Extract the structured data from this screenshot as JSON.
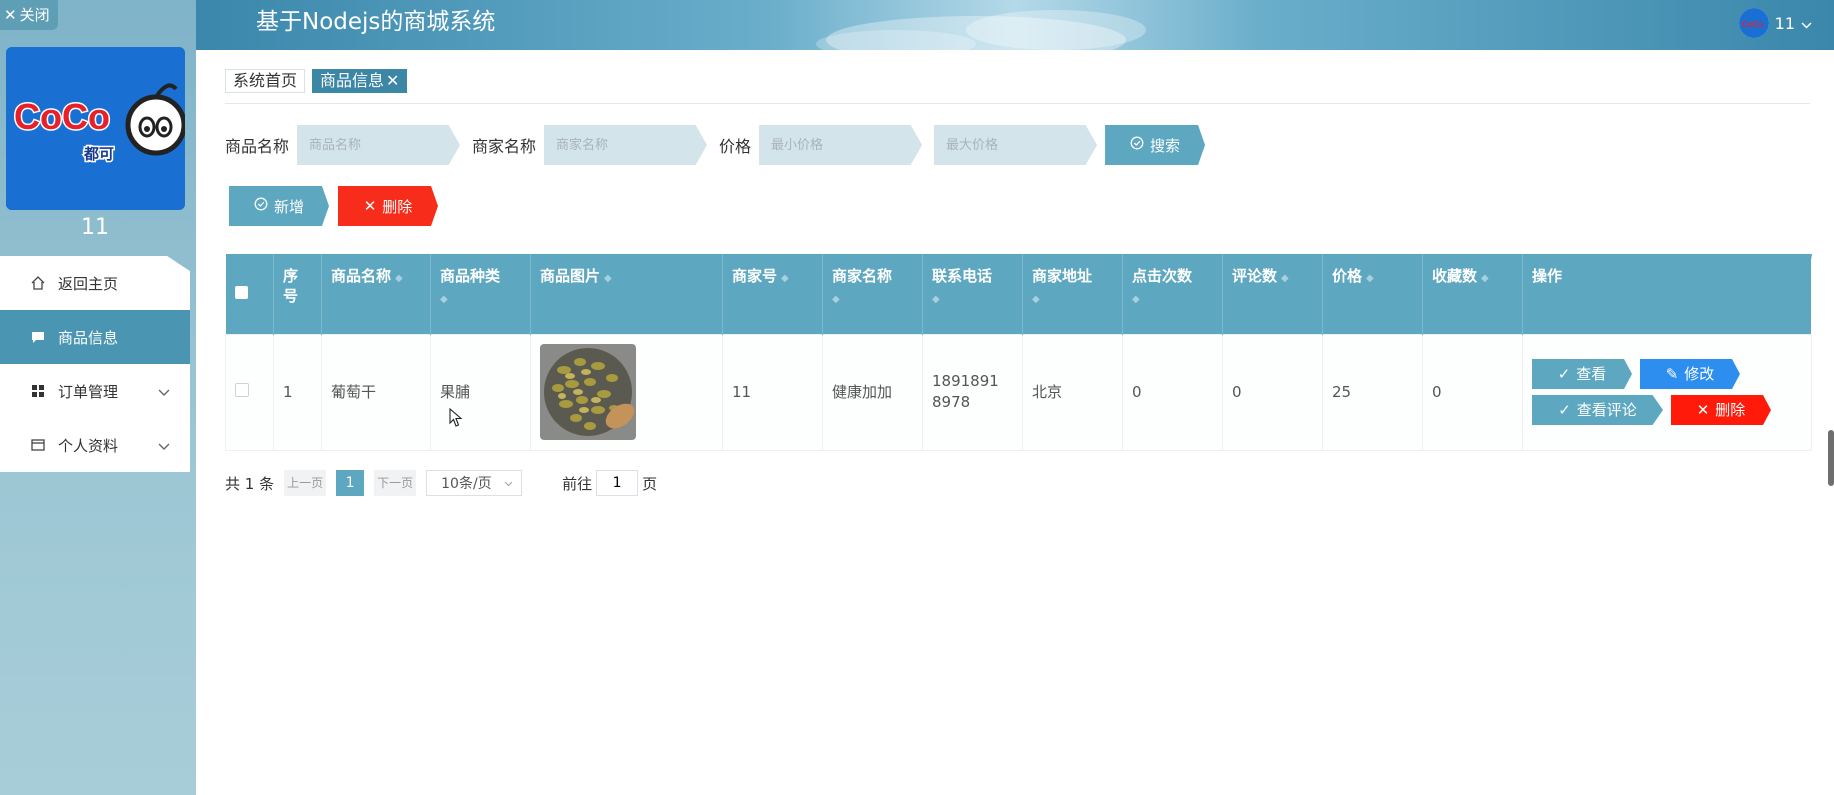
{
  "sidebar": {
    "close_label": "关闭",
    "username": "11",
    "logo_text": "CoCo",
    "logo_subtext": "都可",
    "items": [
      {
        "label": "返回主页",
        "icon": "home-icon"
      },
      {
        "label": "商品信息",
        "icon": "chat-icon"
      },
      {
        "label": "订单管理",
        "icon": "grid-icon"
      },
      {
        "label": "个人资料",
        "icon": "card-icon"
      }
    ]
  },
  "header": {
    "title": "基于Nodejs的商城系统",
    "username": "11"
  },
  "tabs": [
    {
      "label": "系统首页"
    },
    {
      "label": "商品信息"
    }
  ],
  "search": {
    "product_name_label": "商品名称",
    "product_name_placeholder": "商品名称",
    "merchant_name_label": "商家名称",
    "merchant_name_placeholder": "商家名称",
    "price_label": "价格",
    "min_price_placeholder": "最小价格",
    "max_price_placeholder": "最大价格",
    "search_button": "搜索"
  },
  "actions": {
    "add_button": "新增",
    "delete_button": "删除"
  },
  "table": {
    "headers": [
      "序号",
      "商品名称",
      "商品种类",
      "商品图片",
      "商家号",
      "商家名称",
      "联系电话",
      "商家地址",
      "点击次数",
      "评论数",
      "价格",
      "收藏数",
      "操作"
    ],
    "rows": [
      {
        "index": "1",
        "name": "葡萄干",
        "category": "果脯",
        "merchant_no": "11",
        "merchant_name": "健康加加",
        "phone": "18918918978",
        "address": "北京",
        "clicks": "0",
        "comments": "0",
        "price": "25",
        "favorites": "0"
      }
    ],
    "ops": {
      "view": "查看",
      "edit": "修改",
      "view_comments": "查看评论",
      "delete": "删除"
    }
  },
  "pagination": {
    "total_text": "共 1 条",
    "prev": "上一页",
    "current_page": "1",
    "next": "下一页",
    "page_size": "10条/页",
    "goto_label": "前往",
    "goto_value": "1",
    "page_suffix": "页"
  },
  "colors": {
    "primary": "#5ea7c1",
    "danger": "#f72c1a",
    "edit": "#2e8ef0",
    "active_menu": "#4a95b2"
  }
}
